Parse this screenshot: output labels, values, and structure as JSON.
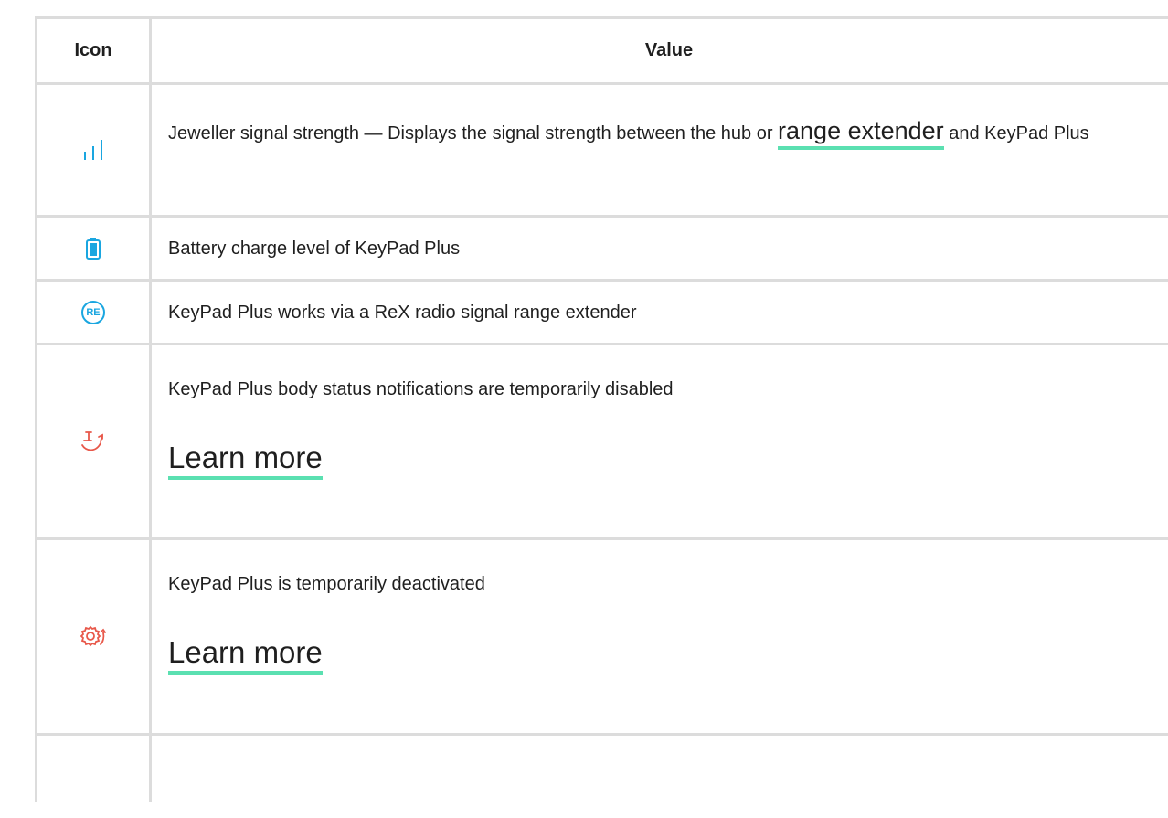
{
  "table": {
    "headers": {
      "icon": "Icon",
      "value": "Value"
    },
    "rows": [
      {
        "icon": "signal-strength-icon",
        "text_before": "Jeweller signal strength — Displays the signal strength between the hub or ",
        "link": "range extender",
        "text_after": " and KeyPad Plus"
      },
      {
        "icon": "battery-icon",
        "text": "Battery charge level of KeyPad Plus"
      },
      {
        "icon": "re-badge-icon",
        "icon_text": "RE",
        "text": "KeyPad Plus works via a ReX radio signal range extender"
      },
      {
        "icon": "body-notifications-disabled-icon",
        "text": "KeyPad Plus body status notifications are temporarily disabled",
        "link": "Learn more"
      },
      {
        "icon": "temporarily-deactivated-icon",
        "text": "KeyPad Plus is temporarily deactivated",
        "link": "Learn more"
      }
    ]
  },
  "colors": {
    "accent_blue": "#1aa6e0",
    "warning_red": "#e8584a",
    "link_underline": "#5be0b1",
    "border": "#dcdcdc"
  }
}
